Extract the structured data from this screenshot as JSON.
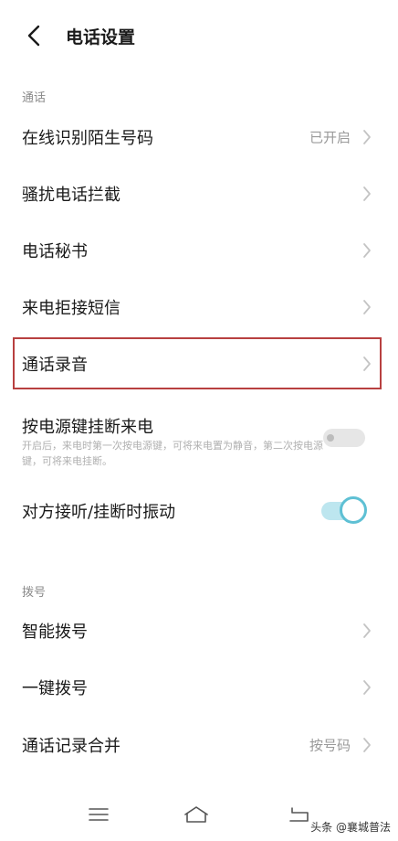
{
  "header": {
    "title": "电话设置",
    "back_icon": "chevron-left-icon"
  },
  "sections": [
    {
      "label": "通话",
      "items": [
        {
          "label": "在线识别陌生号码",
          "value": "已开启",
          "control": "chevron"
        },
        {
          "label": "骚扰电话拦截",
          "value": "",
          "control": "chevron"
        },
        {
          "label": "电话秘书",
          "value": "",
          "control": "chevron"
        },
        {
          "label": "来电拒接短信",
          "value": "",
          "control": "chevron"
        },
        {
          "label": "通话录音",
          "value": "",
          "control": "chevron",
          "highlighted": true
        },
        {
          "label": "按电源键挂断来电",
          "description": "开启后，来电时第一次按电源键，可将来电置为静音，第二次按电源键，可将来电挂断。",
          "control": "toggle",
          "toggle_on": false
        },
        {
          "label": "对方接听/挂断时振动",
          "control": "toggle",
          "toggle_on": true
        }
      ]
    },
    {
      "label": "拨号",
      "items": [
        {
          "label": "智能拨号",
          "value": "",
          "control": "chevron"
        },
        {
          "label": "一键拨号",
          "value": "",
          "control": "chevron"
        },
        {
          "label": "通话记录合并",
          "value": "按号码",
          "control": "chevron"
        }
      ]
    }
  ],
  "bottom_nav": {
    "menu_icon": "menu-icon",
    "home_icon": "home-icon",
    "back_icon": "return-icon"
  },
  "watermark": "头条 @襄城普法",
  "colors": {
    "accent": "#5ec0d4",
    "highlight_border": "#b84040",
    "secondary_text": "#9a9a9a"
  }
}
